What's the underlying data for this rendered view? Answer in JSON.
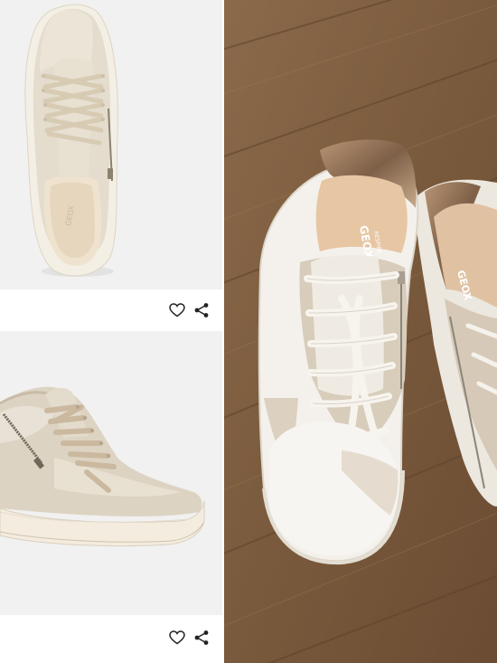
{
  "products": [
    {
      "image_alt": "",
      "actions": {
        "favorite_icon": "heart-icon",
        "share_icon": "share-icon"
      }
    },
    {
      "image_alt": "",
      "actions": {
        "favorite_icon": "heart-icon",
        "share_icon": "share-icon"
      }
    }
  ],
  "photo": {
    "brand_text_left": "GEOX",
    "brand_sub_left": "RESPIRA",
    "brand_text_right": "GEOX"
  },
  "colors": {
    "panel_bg": "#f1f1f1",
    "floor": "#7a5a3d",
    "shoe_white": "#f2efe9",
    "suede": "#d9cdbd",
    "metallic": "#e2dccf",
    "glitter": "#9b7a5e"
  }
}
